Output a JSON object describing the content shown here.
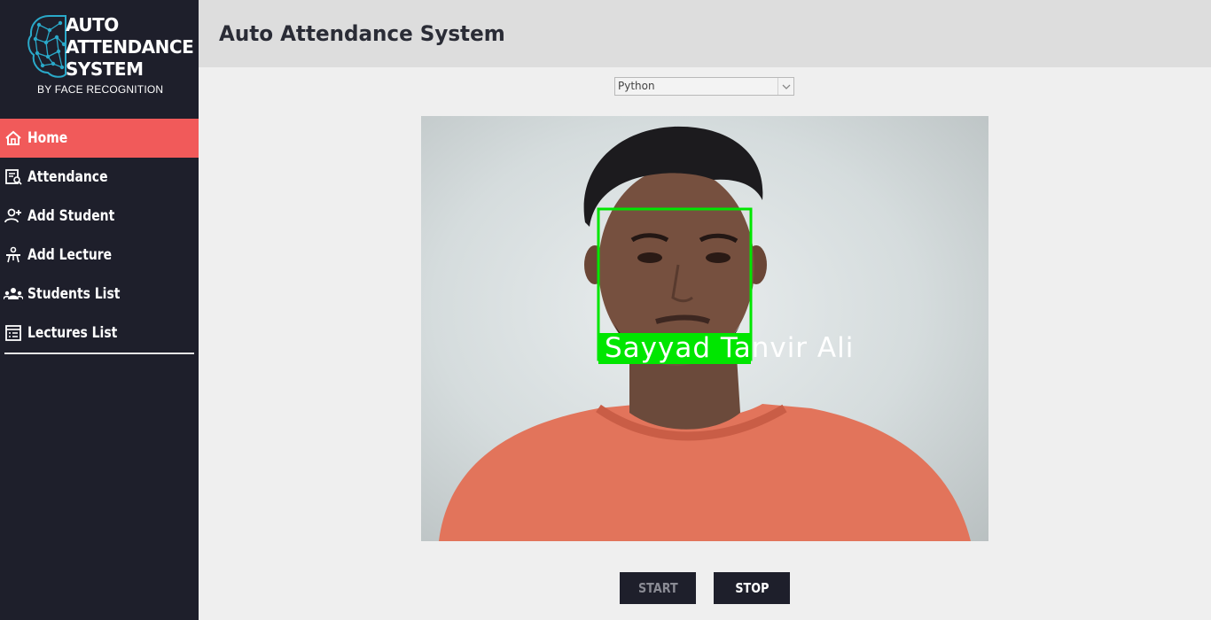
{
  "brand": {
    "title_line1": "AUTO",
    "title_line2": "ATTENDANCE",
    "title_line3": "SYSTEM",
    "subtitle": "BY FACE RECOGNITION"
  },
  "sidebar": {
    "items": [
      {
        "label": "Home",
        "icon": "home-icon",
        "active": true
      },
      {
        "label": "Attendance",
        "icon": "attendance-icon",
        "active": false
      },
      {
        "label": "Add Student",
        "icon": "add-user-icon",
        "active": false
      },
      {
        "label": "Add Lecture",
        "icon": "lecture-icon",
        "active": false
      },
      {
        "label": "Students List",
        "icon": "group-icon",
        "active": false
      },
      {
        "label": "Lectures List",
        "icon": "list-icon",
        "active": false
      }
    ]
  },
  "header": {
    "title": "Auto Attendance System"
  },
  "subject_select": {
    "selected": "Python"
  },
  "camera": {
    "recognized_name": "Sayyad Tanvir Ali"
  },
  "controls": {
    "start_label": "START",
    "stop_label": "STOP"
  },
  "colors": {
    "sidebar_bg": "#1e1f2b",
    "active_item": "#f15a5a",
    "header_bg": "#dddddd",
    "face_box": "#00e600",
    "logo_accent": "#2aa9c9"
  }
}
